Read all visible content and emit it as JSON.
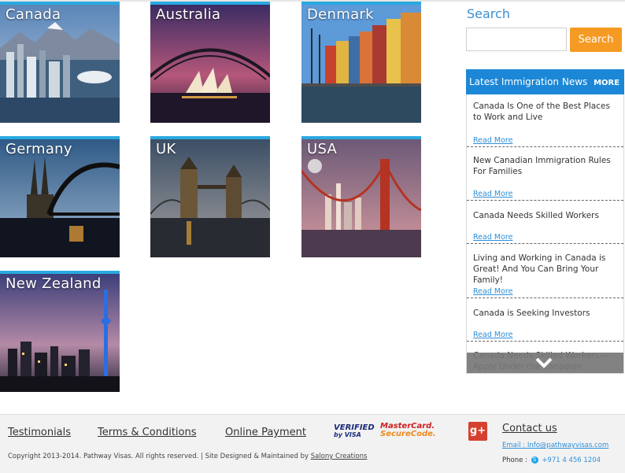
{
  "countries": [
    {
      "name": "Canada"
    },
    {
      "name": "Australia"
    },
    {
      "name": "Denmark"
    },
    {
      "name": "Germany"
    },
    {
      "name": "UK"
    },
    {
      "name": "USA"
    },
    {
      "name": "New Zealand"
    }
  ],
  "search": {
    "title": "Search",
    "placeholder": "",
    "button": "Search"
  },
  "news": {
    "title": "Latest Immigration News",
    "more": "MORE",
    "read_more": "Read More",
    "items": [
      "Canada Is One of the Best Places to Work and Live",
      "New Canadian Immigration Rules For Families",
      "Canada Needs Skilled Workers",
      "Living and Working in Canada is Great! And You Can Bring Your Family!",
      "Canada is Seeking Investors",
      "Canada Needs Skilled Workers—Apply Under the Canadian Provincial Nomi-"
    ]
  },
  "footer": {
    "links": [
      "Testimonials",
      "Terms & Conditions",
      "Online Payment"
    ],
    "vbv_top": "VERIFIED",
    "vbv_bottom": "by VISA",
    "mc_top": "MasterCard.",
    "mc_bottom": "SecureCode.",
    "copyright": "Copyright 2013-2014. Pathway Visas. All rights reserved. | Site Designed & Maintained by",
    "designer": "Salony Creations",
    "gplus": "g+",
    "contact_title": "Contact us",
    "email": "Email : Info@pathwayvisas.com",
    "phone_label": "Phone :",
    "skype_glyph": "S",
    "phone": "+971 4 456 1204"
  },
  "colors": {
    "accent": "#29a9e0",
    "news_header": "#1c87d6",
    "search_button": "#f59b23",
    "gplus": "#d6402e"
  }
}
